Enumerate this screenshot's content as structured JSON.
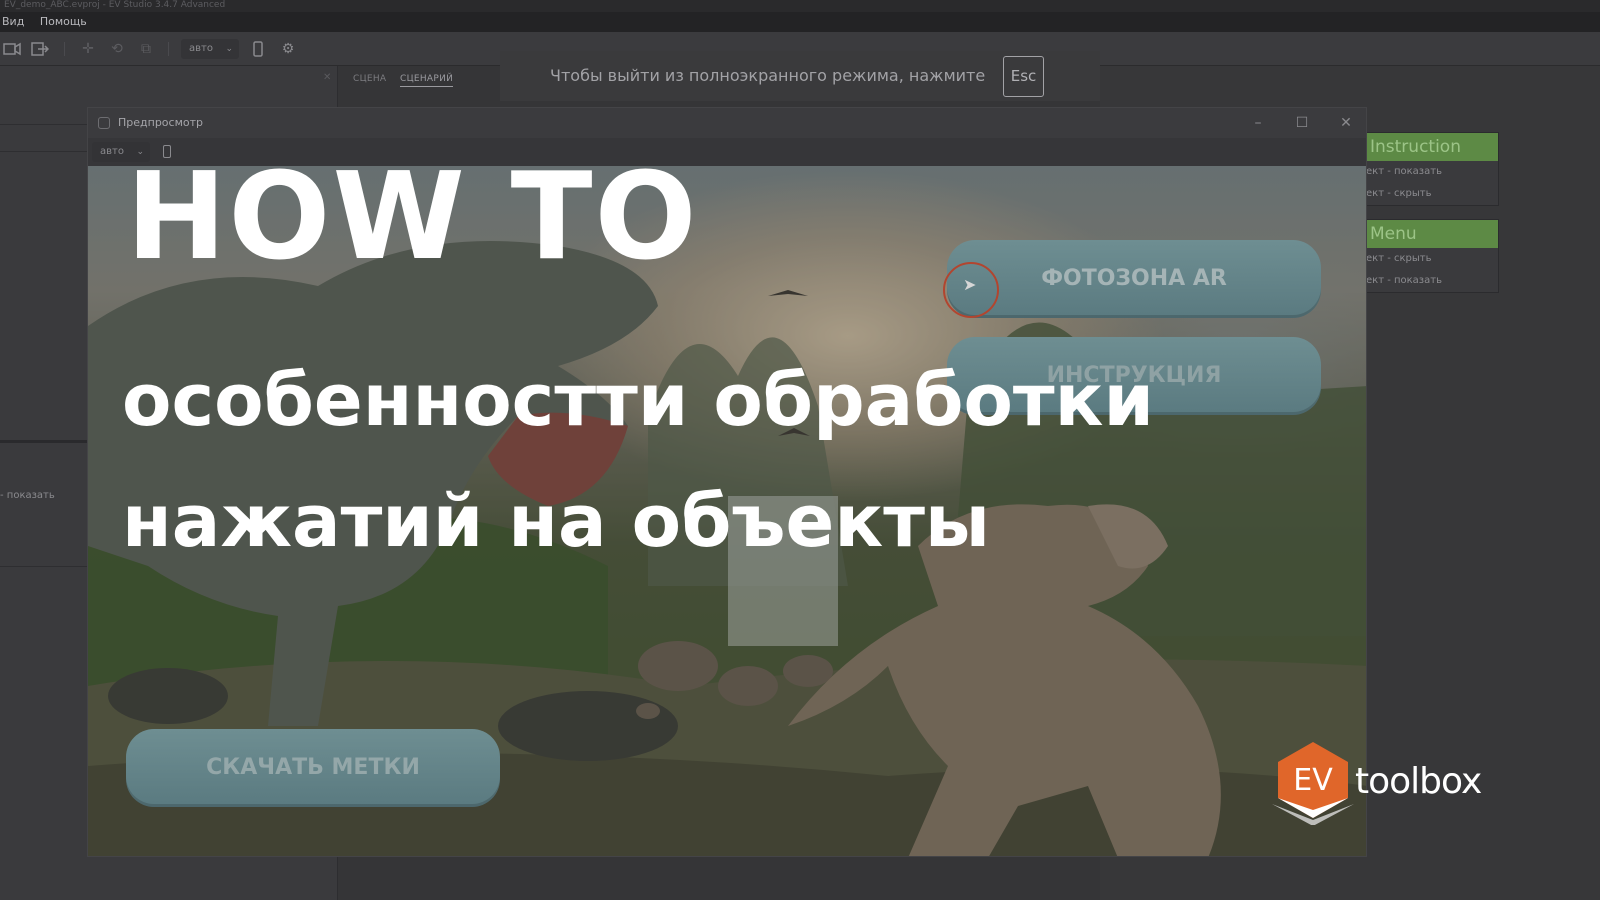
{
  "window": {
    "title": "EV_demo_ABC.evproj - EV Studio 3.4.7 Advanced"
  },
  "menu": {
    "items": [
      "Вид",
      "Помощь"
    ]
  },
  "toolbar": {
    "scale_value": "авто"
  },
  "left_panel": {
    "show_label": "- показать"
  },
  "tabs": {
    "items": [
      "СЦЕНА",
      "СЦЕНАРИЙ"
    ],
    "active": "СЦЕНАРИЙ"
  },
  "fullscreen_hint": {
    "text": "Чтобы выйти из полноэкранного режима, нажмите",
    "key": "Esc"
  },
  "nodes": [
    {
      "title": "Instruction",
      "rows": [
        "ект - показать",
        "ект - скрыть"
      ],
      "color": "#5d8a45"
    },
    {
      "title": "Menu",
      "rows": [
        "ект - скрыть",
        "ект - показать"
      ],
      "color": "#5d8a45"
    }
  ],
  "preview": {
    "title": "Предпросмотр",
    "scale_value": "авто",
    "controls": [
      "minimize-icon",
      "maximize-icon",
      "close-icon"
    ]
  },
  "scene_buttons": {
    "photo_zone": "ФОТОЗОНА AR",
    "instruction": "ИНСТРУКЦИЯ",
    "download": "СКАЧАТЬ МЕТКИ",
    "button_color": "#5f8085"
  },
  "overlay": {
    "headline": "HOW TO",
    "line1": "особенностти обработки",
    "line2": "нажатий на объекты"
  },
  "logo": {
    "mark": "EV",
    "name": "toolbox",
    "accent": "#e0662a"
  }
}
